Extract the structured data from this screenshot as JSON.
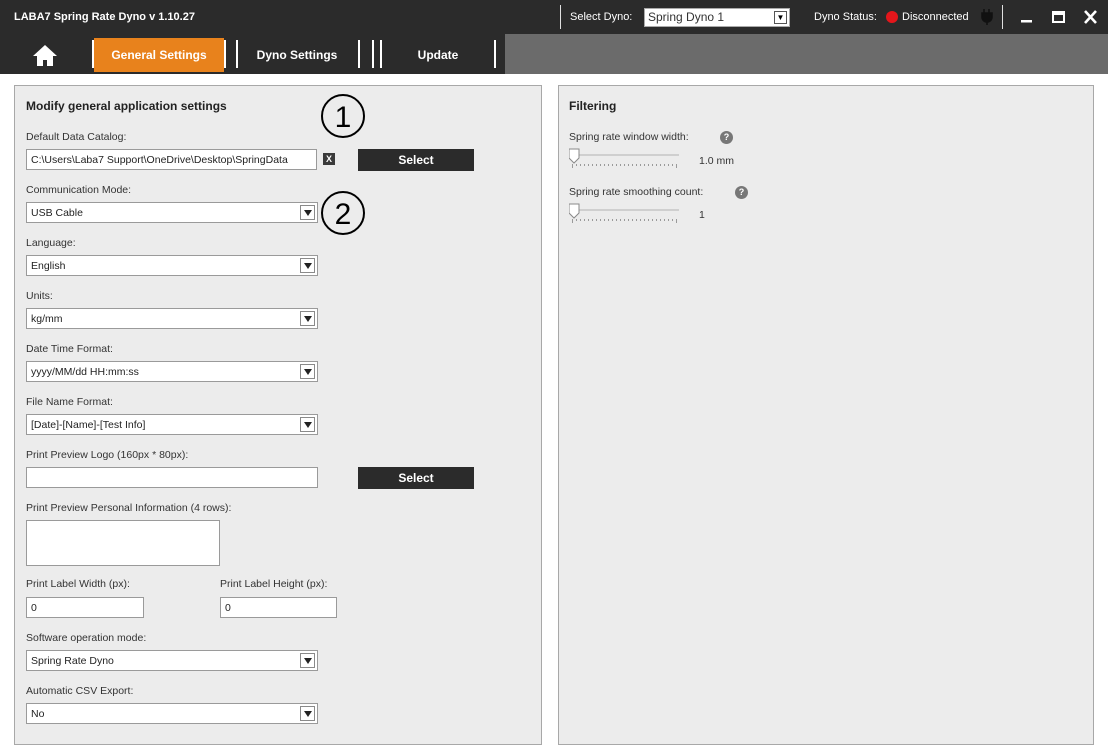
{
  "window": {
    "title": "LABA7 Spring Rate Dyno  v 1.10.27",
    "select_dyno_label": "Select Dyno:",
    "selected_dyno": "Spring Dyno 1",
    "status_label": "Dyno Status:",
    "status_value": "Disconnected",
    "status_color": "#e4161b",
    "controls": [
      "minimize-icon",
      "maximize-icon",
      "close-icon"
    ]
  },
  "nav": {
    "home_icon": "home-icon",
    "active_color": "#e8821c",
    "tabs": [
      {
        "label": "General Settings",
        "active": true
      },
      {
        "label": "Dyno Settings",
        "active": false
      },
      {
        "label": "Update",
        "active": false
      }
    ]
  },
  "general": {
    "title": "Modify general application settings",
    "default_catalog": {
      "label": "Default Data Catalog:",
      "value": "C:\\Users\\Laba7 Support\\OneDrive\\Desktop\\SpringData",
      "clear_label": "X",
      "button": "Select"
    },
    "communication_mode": {
      "label": "Communication Mode:",
      "value": "USB Cable"
    },
    "language": {
      "label": "Language:",
      "value": "English"
    },
    "units": {
      "label": "Units:",
      "value": "kg/mm"
    },
    "date_time_format": {
      "label": "Date Time Format:",
      "value": "yyyy/MM/dd HH:mm:ss"
    },
    "file_name_format": {
      "label": "File Name Format:",
      "value": "[Date]-[Name]-[Test Info]"
    },
    "print_logo": {
      "label": "Print Preview Logo (160px * 80px):",
      "value": "",
      "button": "Select"
    },
    "personal_info": {
      "label": "Print Preview Personal Information (4 rows):",
      "value": ""
    },
    "label_width": {
      "label": "Print Label Width (px):",
      "value": "0"
    },
    "label_height": {
      "label": "Print Label Height (px):",
      "value": "0"
    },
    "operation_mode": {
      "label": "Software operation mode:",
      "value": "Spring Rate Dyno"
    },
    "csv_export": {
      "label": "Automatic CSV Export:",
      "value": "No"
    }
  },
  "annotations": [
    "1",
    "2"
  ],
  "filtering": {
    "title": "Filtering",
    "window_width": {
      "label": "Spring rate window width:",
      "value": "1.0 mm",
      "level": 0
    },
    "smoothing_count": {
      "label": "Spring rate smoothing count:",
      "value": "1",
      "level": 0
    }
  }
}
